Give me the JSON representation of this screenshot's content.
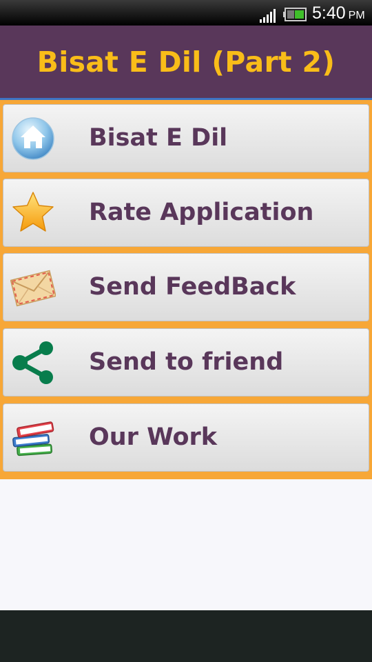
{
  "status_bar": {
    "time": "5:40",
    "ampm": "PM"
  },
  "header": {
    "title": "Bisat E Dil (Part 2)"
  },
  "menu": {
    "items": [
      {
        "label": "Bisat E Dil",
        "icon": "home-icon"
      },
      {
        "label": "Rate Application",
        "icon": "star-icon"
      },
      {
        "label": "Send FeedBack",
        "icon": "envelope-icon"
      },
      {
        "label": "Send to friend",
        "icon": "share-icon"
      },
      {
        "label": "Our Work",
        "icon": "books-icon"
      }
    ]
  },
  "colors": {
    "header_bg": "#59375a",
    "title": "#f9bd19",
    "menu_bg": "#f7a737",
    "label": "#59375a"
  }
}
